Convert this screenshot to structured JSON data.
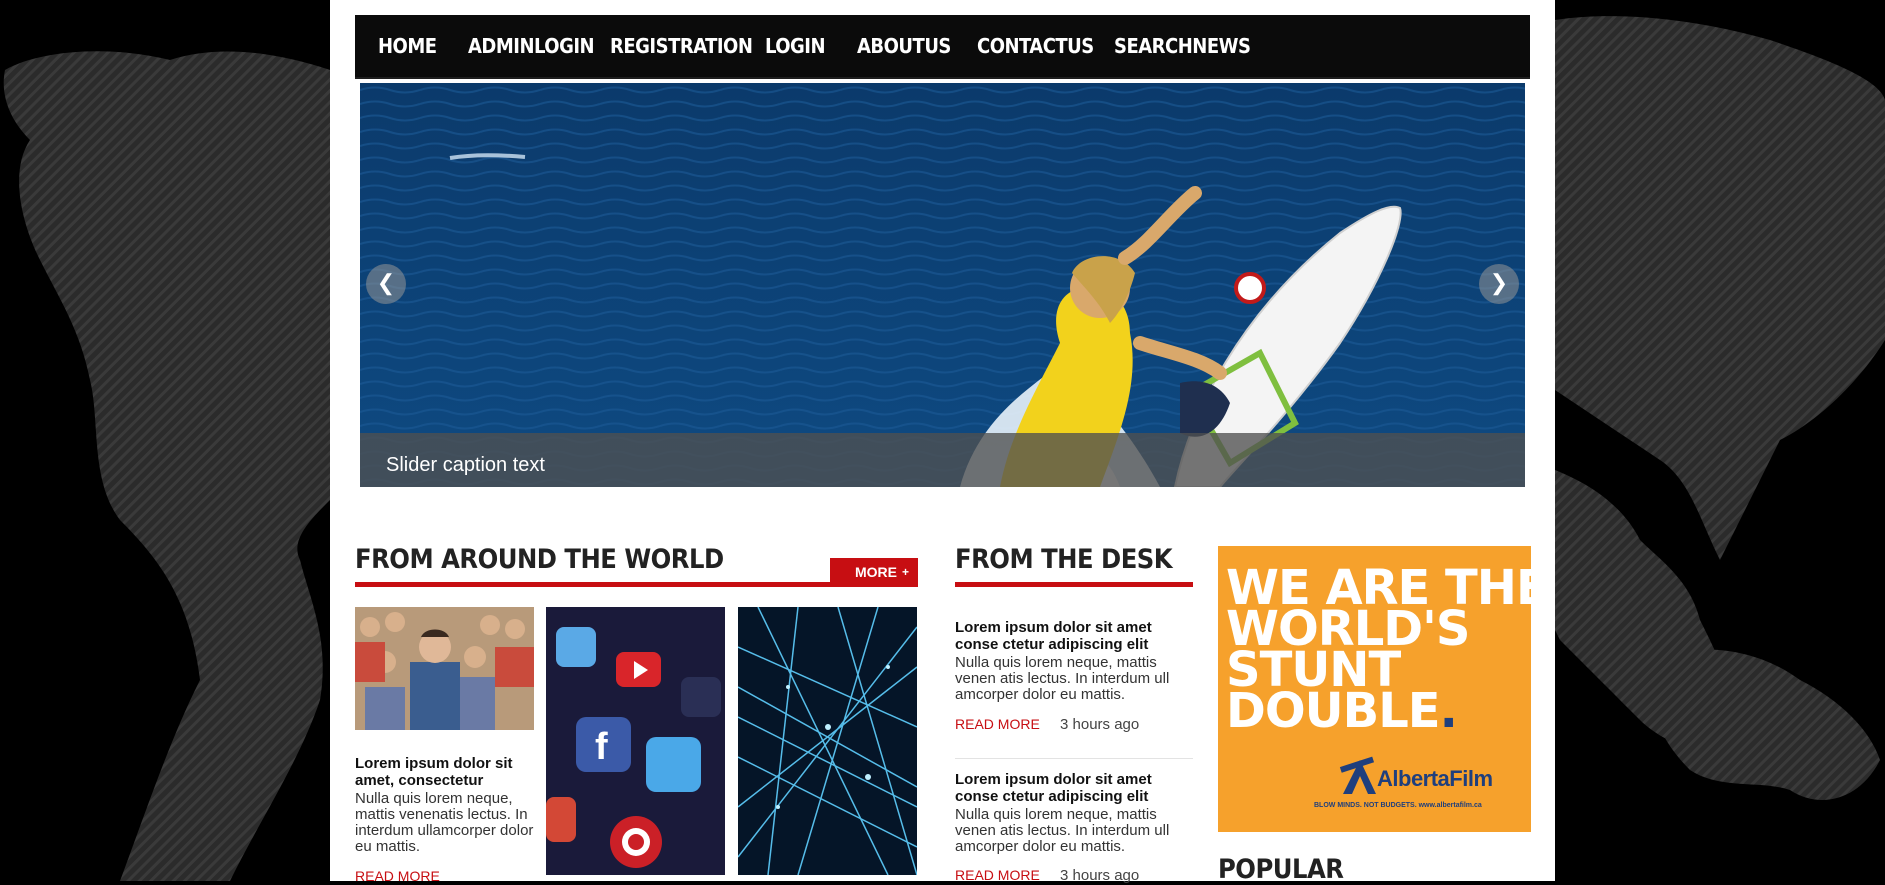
{
  "nav": {
    "items": [
      {
        "label": "Home"
      },
      {
        "label": "AdminLogin"
      },
      {
        "label": "Registration"
      },
      {
        "label": "Login"
      },
      {
        "label": "AboutUs"
      },
      {
        "label": "ContactUs"
      },
      {
        "label": "SearchNews"
      }
    ]
  },
  "slider": {
    "caption": "Slider caption text",
    "prev_icon": "chevron-left-icon",
    "next_icon": "chevron-right-icon"
  },
  "world": {
    "heading": "From Around the World",
    "more_label": "MORE",
    "more_icon": "plus-icon",
    "story": {
      "title": "Lorem ipsum dolor sit amet, consectetur",
      "body": "Nulla quis lorem neque, mattis venenatis lectus. In interdum ullamcorper dolor eu mattis.",
      "read_more": "READ MORE"
    }
  },
  "desk": {
    "heading": "From the Desk",
    "stories": [
      {
        "title": "Lorem ipsum dolor sit amet conse ctetur adipiscing elit",
        "body": "Nulla quis lorem neque, mattis venen atis lectus. In interdum ull amcorper dolor eu mattis.",
        "read_more": "READ MORE",
        "time": "3 hours ago"
      },
      {
        "title": "Lorem ipsum dolor sit amet conse ctetur adipiscing elit",
        "body": "Nulla quis lorem neque, mattis venen atis lectus. In interdum ull amcorper dolor eu mattis.",
        "read_more": "READ MORE",
        "time": "3 hours ago"
      }
    ]
  },
  "ad": {
    "lines": [
      "WE ARE THE",
      "WORLD'S",
      "STUNT",
      "DOUBLE"
    ],
    "period": ".",
    "brand": "AlbertaFilm",
    "tagline": "BLOW MINDS. NOT BUDGETS.   www.albertafilm.ca"
  },
  "popular": {
    "heading": "Popular"
  },
  "colors": {
    "accent": "#c70e12",
    "nav_bg": "#0b0b0b",
    "ad_bg": "#f6a12c",
    "ad_brand": "#1f3f7d"
  }
}
